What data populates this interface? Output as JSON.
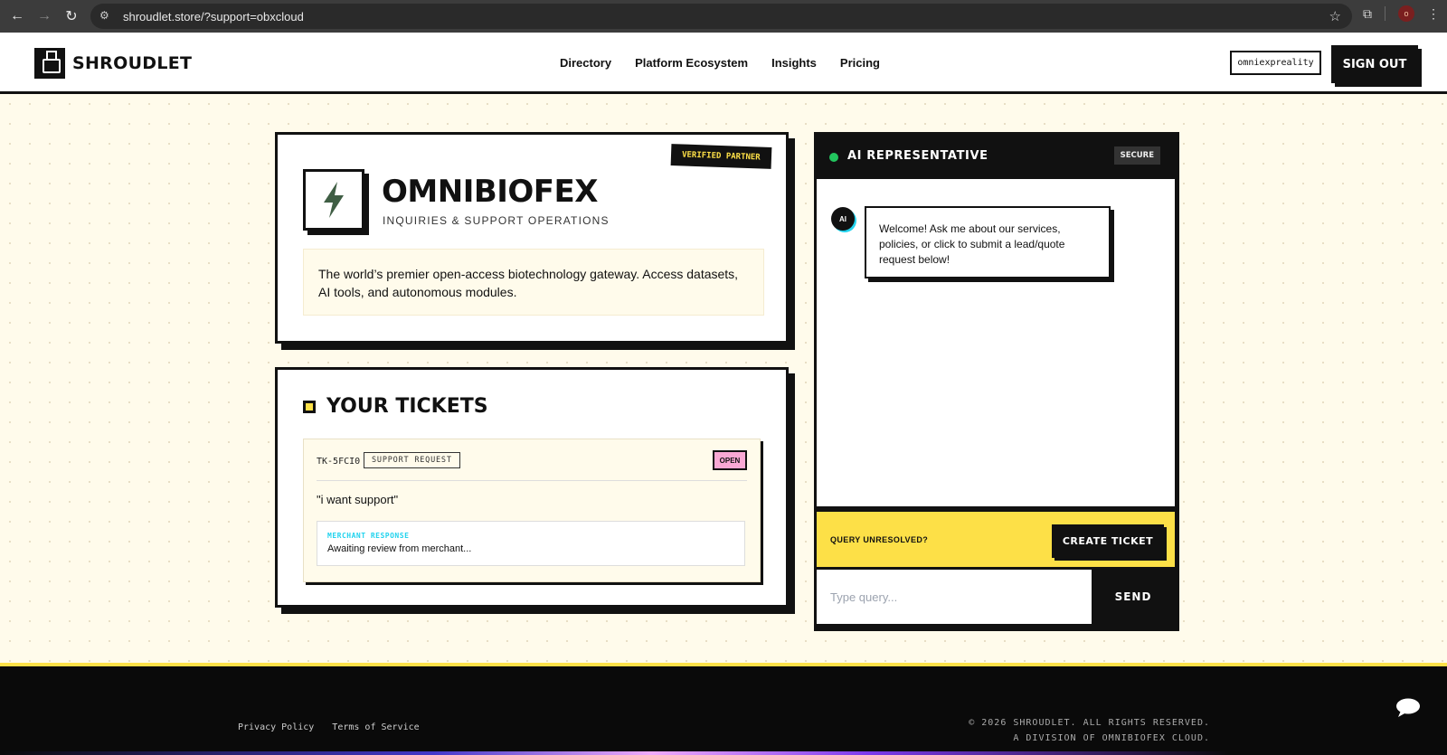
{
  "browser": {
    "url": "shroudlet.store/?support=obxcloud",
    "back_icon": "←",
    "forward_icon": "→",
    "reload_icon": "↻",
    "profile_initial": "o"
  },
  "header": {
    "brand": "SHROUDLET",
    "nav": [
      "Directory",
      "Platform Ecosystem",
      "Insights",
      "Pricing"
    ],
    "user": "omniexpreality",
    "signout": "SIGN OUT"
  },
  "hero": {
    "badge": "VERIFIED PARTNER",
    "title": "OMNIBIOFEX",
    "subtitle": "INQUIRIES & SUPPORT OPERATIONS",
    "description": "The world’s premier open-access biotechnology gateway. Access datasets, AI tools, and autonomous modules."
  },
  "tickets": {
    "heading": "YOUR TICKETS",
    "items": [
      {
        "id": "TK-5FCI0",
        "type": "SUPPORT REQUEST",
        "status": "OPEN",
        "message": "\"i want support\"",
        "response_label": "MERCHANT RESPONSE",
        "response_text": "Awaiting review from merchant..."
      }
    ]
  },
  "chat": {
    "title": "AI REPRESENTATIVE",
    "badge": "SECURE",
    "avatar": "AI",
    "welcome": "Welcome! Ask me about our services, policies, or click to submit a lead/quote request below!",
    "unresolved_label": "QUERY UNRESOLVED?",
    "create_ticket": "CREATE TICKET",
    "input_placeholder": "Type query...",
    "send": "SEND"
  },
  "footer": {
    "links": [
      "Privacy Policy",
      "Terms of Service"
    ],
    "copyright": "© 2026 SHROUDLET. ALL RIGHTS RESERVED.",
    "division": "A DIVISION OF OMNIBIOFEX CLOUD."
  },
  "colors": {
    "accent_yellow": "#fde047",
    "bg_cream": "#fffbeb",
    "ink": "#111111",
    "status_pink": "#f9a8d4",
    "online_green": "#22c55e",
    "cyan": "#22d3ee"
  }
}
